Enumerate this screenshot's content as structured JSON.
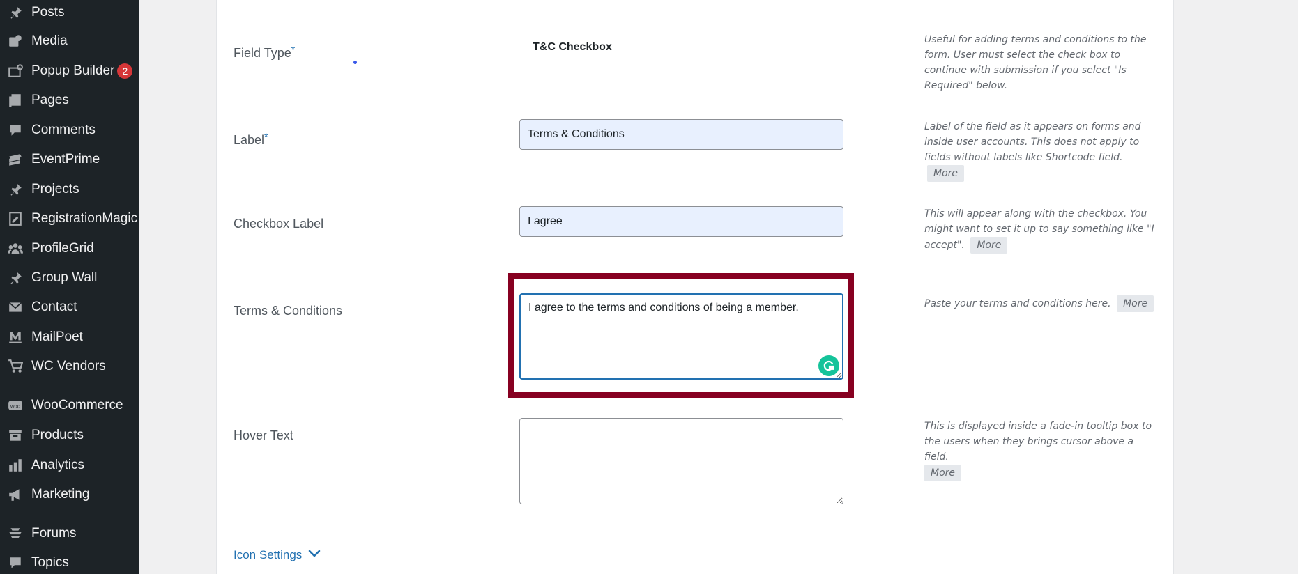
{
  "sidebar": {
    "items": [
      {
        "label": "Posts",
        "icon": "pin-icon"
      },
      {
        "label": "Media",
        "icon": "media-icon"
      },
      {
        "label": "Popup Builder",
        "icon": "popup-icon",
        "badge": "2"
      },
      {
        "label": "Pages",
        "icon": "pages-icon"
      },
      {
        "label": "Comments",
        "icon": "comment-icon"
      },
      {
        "label": "EventPrime",
        "icon": "ticket-icon"
      },
      {
        "label": "Projects",
        "icon": "pin-icon"
      },
      {
        "label": "RegistrationMagic",
        "icon": "form-icon"
      },
      {
        "label": "ProfileGrid",
        "icon": "users-icon"
      },
      {
        "label": "Group Wall",
        "icon": "pin-icon"
      },
      {
        "label": "Contact",
        "icon": "mail-icon"
      },
      {
        "label": "MailPoet",
        "icon": "mailpoet-icon"
      },
      {
        "label": "WC Vendors",
        "icon": "cart-icon"
      },
      {
        "label": "WooCommerce",
        "icon": "woo-icon"
      },
      {
        "label": "Products",
        "icon": "archive-icon"
      },
      {
        "label": "Analytics",
        "icon": "bar-chart-icon"
      },
      {
        "label": "Marketing",
        "icon": "megaphone-icon"
      },
      {
        "label": "Forums",
        "icon": "forums-icon"
      },
      {
        "label": "Topics",
        "icon": "topics-icon"
      }
    ]
  },
  "form": {
    "field_type": {
      "label": "Field Type",
      "required_mark": "*",
      "value": "T&C Checkbox",
      "help": "Useful for adding terms and conditions to the form. User must select the check box to continue with submission if you select \"Is Required\" below."
    },
    "label_field": {
      "label": "Label",
      "required_mark": "*",
      "value": "Terms & Conditions",
      "help": "Label of the field as it appears on forms and inside user accounts. This does not apply to fields without labels like Shortcode field.",
      "more": "More"
    },
    "checkbox_label": {
      "label": "Checkbox Label",
      "value": "I agree",
      "help": "This will appear along with the checkbox. You might want to set it up to say something like \"I accept\".",
      "more": "More"
    },
    "terms": {
      "label": "Terms & Conditions",
      "value": "I agree to the terms and conditions of being a member.",
      "help": "Paste your terms and conditions here.",
      "more": "More"
    },
    "hover_text": {
      "label": "Hover Text",
      "value": "",
      "help": "This is displayed inside a fade-in tooltip box to the users when they brings cursor above a field.",
      "more": "More"
    },
    "icon_settings": {
      "label": "Icon Settings"
    }
  },
  "colors": {
    "sidebar_bg": "#1d2327",
    "highlight": "#870021",
    "accent": "#2271b1",
    "grammarly": "#15c39a",
    "badge": "#d63638"
  }
}
